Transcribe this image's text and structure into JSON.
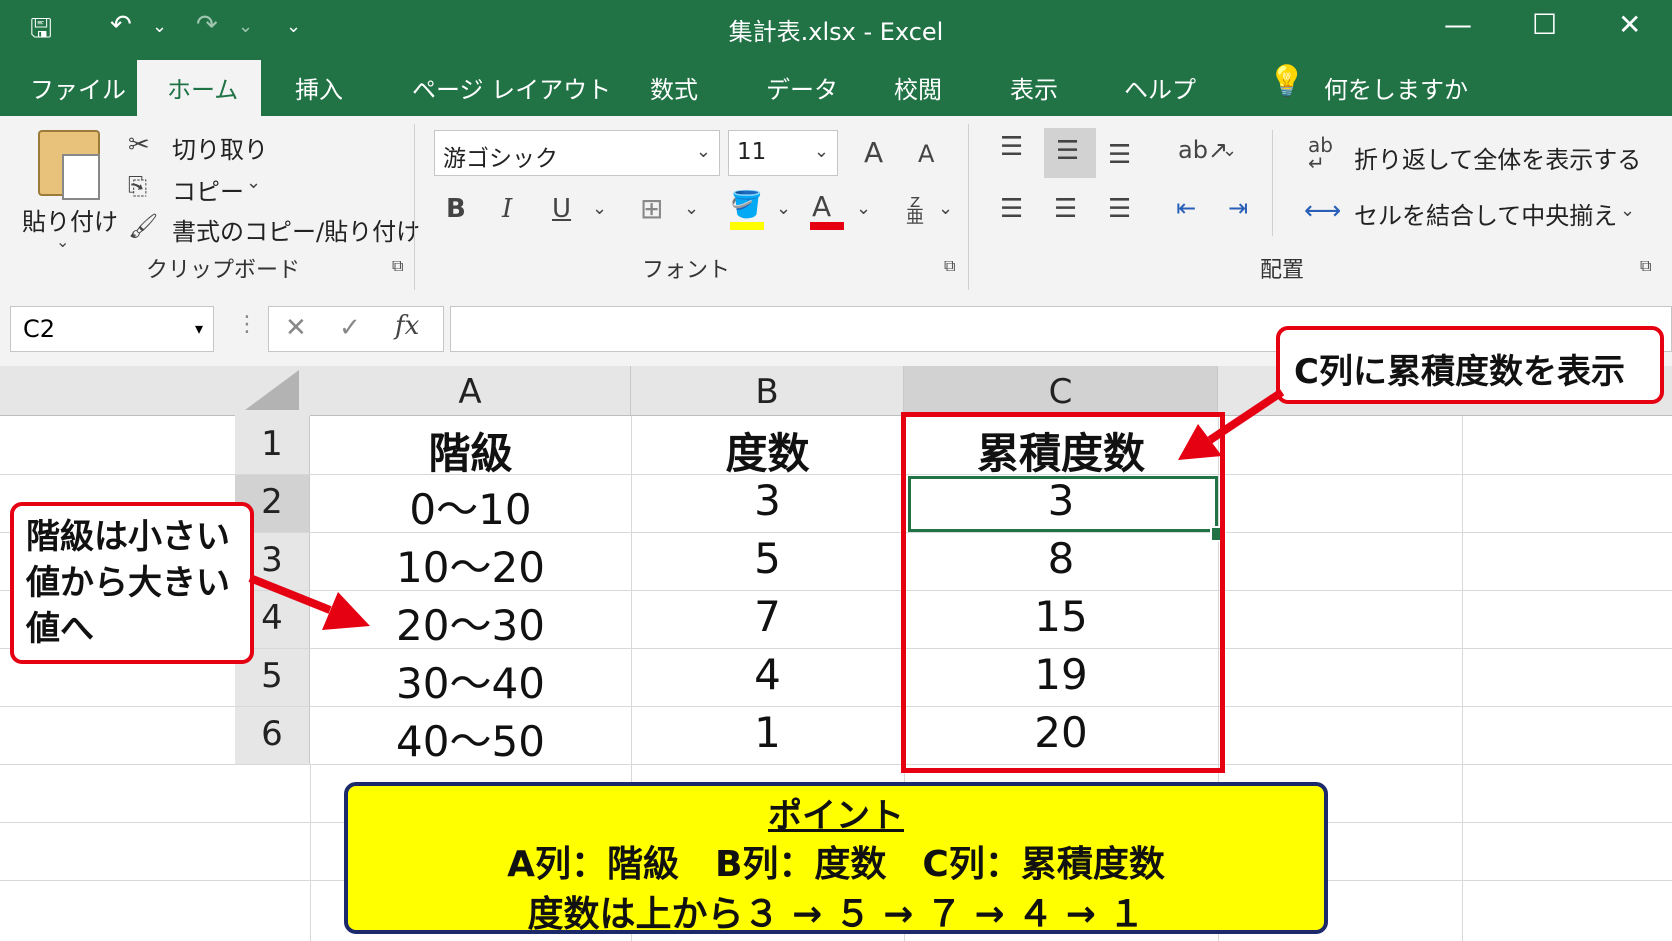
{
  "window": {
    "title": "集計表.xlsx - Excel",
    "minimize": "—",
    "maximize": "☐",
    "close": "✕"
  },
  "quick_access": {
    "save": "🖫",
    "undo": "↶",
    "redo": "↷",
    "customize": "⌄"
  },
  "tabs": [
    "ファイル",
    "ホーム",
    "挿入",
    "ページ レイアウト",
    "数式",
    "データ",
    "校閲",
    "表示",
    "ヘルプ"
  ],
  "tell_me": "何をしますか",
  "ribbon": {
    "clipboard": {
      "paste": "貼り付け",
      "cut": "切り取り",
      "copy": "コピー",
      "format_painter": "書式のコピー/貼り付け",
      "group_label": "クリップボード"
    },
    "font": {
      "font_name": "游ゴシック",
      "font_size": "11",
      "bold": "B",
      "italic": "I",
      "underline": "U",
      "grow": "A",
      "shrink": "A",
      "font_color": "A",
      "group_label": "フォント"
    },
    "alignment": {
      "wrap_text": "折り返して全体を表示する",
      "merge_center": "セルを結合して中央揃え",
      "group_label": "配置"
    }
  },
  "formula_bar": {
    "name_box": "C2",
    "cancel": "✕",
    "enter": "✓",
    "fx": "fx",
    "value": ""
  },
  "columns": [
    "A",
    "B",
    "C"
  ],
  "rows": [
    {
      "n": "1",
      "a": "階級",
      "b": "度数",
      "c": "累積度数"
    },
    {
      "n": "2",
      "a": "0〜10",
      "b": "3",
      "c": "3"
    },
    {
      "n": "3",
      "a": "10〜20",
      "b": "5",
      "c": "8"
    },
    {
      "n": "4",
      "a": "20〜30",
      "b": "7",
      "c": "15"
    },
    {
      "n": "5",
      "a": "30〜40",
      "b": "4",
      "c": "19"
    },
    {
      "n": "6",
      "a": "40〜50",
      "b": "1",
      "c": "20"
    }
  ],
  "annotations": {
    "top_callout": "C列に累積度数を表示",
    "left_callout": [
      "階級は小さい",
      "値から大きい",
      "値へ"
    ],
    "point_title": "ポイント",
    "point_line1": "A列：階級　B列：度数　C列：累積度数",
    "point_line2": "度数は上から３ → ５ → ７ → ４ → １"
  },
  "colors": {
    "excel_green": "#217346",
    "annotation_red": "#e50012",
    "highlight_yellow": "#ffff00",
    "point_border": "#1c2a6b"
  }
}
